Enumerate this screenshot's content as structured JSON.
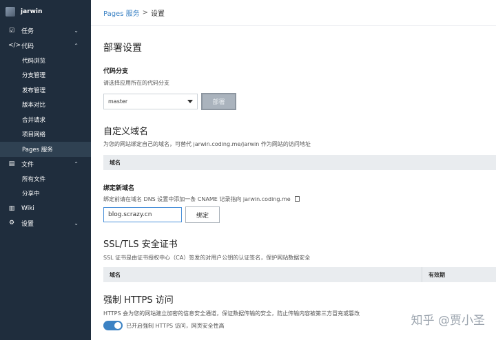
{
  "sidebar": {
    "user": "jarwin",
    "items": [
      {
        "label": "任务",
        "icon": "checkbox-icon"
      },
      {
        "label": "代码",
        "icon": "code-icon"
      },
      {
        "label": "代码浏览"
      },
      {
        "label": "分支管理"
      },
      {
        "label": "发布管理"
      },
      {
        "label": "版本对比"
      },
      {
        "label": "合并请求"
      },
      {
        "label": "项目网络"
      },
      {
        "label": "Pages 服务"
      },
      {
        "label": "文件",
        "icon": "file-icon"
      },
      {
        "label": "所有文件"
      },
      {
        "label": "分享中"
      },
      {
        "label": "Wiki",
        "icon": "book-icon"
      },
      {
        "label": "设置",
        "icon": "gear-icon"
      }
    ]
  },
  "breadcrumb": {
    "parent": "Pages 服务",
    "separator": ">",
    "current": "设置"
  },
  "deploy": {
    "title": "部署设置",
    "branch_label": "代码分支",
    "branch_desc": "请选择应用所在的代码分支",
    "branch_value": "master",
    "deploy_button": "部署"
  },
  "domain": {
    "title": "自定义域名",
    "desc": "为您的网站绑定自己的域名，可替代 jarwin.coding.me/jarwin 作为网站的访问地址",
    "col_domain": "域名",
    "bind_label": "绑定新域名",
    "bind_desc": "绑定前请在域名 DNS 设置中添加一条 CNAME 记录指向 jarwin.coding.me",
    "input_value": "blog.scrazy.cn",
    "bind_button": "绑定"
  },
  "ssl": {
    "title": "SSL/TLS 安全证书",
    "desc": "SSL 证书是由证书授权中心（CA）签发的对用户公钥的认证签名，保护网站数据安全",
    "col_domain": "域名",
    "col_valid": "有效期"
  },
  "https": {
    "title": "强制 HTTPS 访问",
    "desc": "HTTPS 会为您的网站建立加密的信息安全通道，保证数据传输的安全，防止传输内容被第三方冒充或篡改",
    "toggle_text": "已开启强制 HTTPS 访问，网页安全性高"
  },
  "watermark": "知乎 @贾小圣",
  "colors": {
    "sidebar": "#1f2d3d",
    "accent": "#3b82c4"
  }
}
